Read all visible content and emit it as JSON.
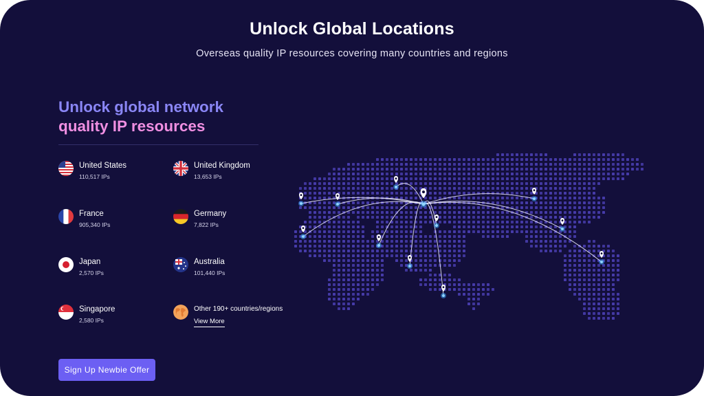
{
  "header": {
    "title": "Unlock Global Locations",
    "subtitle": "Overseas quality IP resources covering many countries and regions"
  },
  "headline": {
    "line1": "Unlock global network",
    "line2": "quality IP resources"
  },
  "colors": {
    "background": "#130f3b",
    "headline_line1": "#8a86f5",
    "headline_line2": "#f08fe2",
    "accent_button": "#6c5ff3",
    "map_dots": "#4b3fb3"
  },
  "countries": [
    {
      "name": "United States",
      "ips": "110,517 IPs",
      "flag_icon": "us-flag-icon"
    },
    {
      "name": "United Kingdom",
      "ips": "13,653 IPs",
      "flag_icon": "uk-flag-icon"
    },
    {
      "name": "France",
      "ips": "905,340 IPs",
      "flag_icon": "france-flag-icon"
    },
    {
      "name": "Germany",
      "ips": "7,822 IPs",
      "flag_icon": "germany-flag-icon"
    },
    {
      "name": "Japan",
      "ips": "2,570 IPs",
      "flag_icon": "japan-flag-icon"
    },
    {
      "name": "Australia",
      "ips": "101,440 IPs",
      "flag_icon": "australia-flag-icon"
    },
    {
      "name": "Singapore",
      "ips": "2,580 IPs",
      "flag_icon": "singapore-flag-icon"
    }
  ],
  "other": {
    "label": "Other 190+ countries/regions",
    "link": "View More",
    "icon": "globe-icon"
  },
  "cta": {
    "label": "Sign Up Newbie Offer"
  }
}
